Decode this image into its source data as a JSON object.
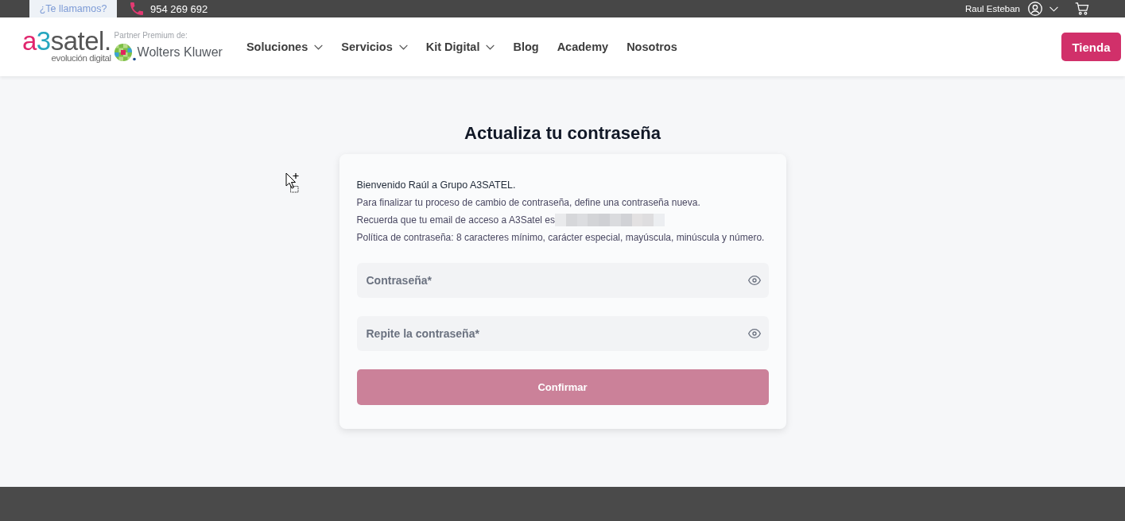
{
  "top_bar": {
    "callback_label": "¿Te llamamos?",
    "phone": "954 269 692",
    "user_name": "Raul Esteban"
  },
  "header": {
    "logo": {
      "wordmark": [
        "a",
        "3",
        "satel."
      ],
      "tagline": "evolución digital"
    },
    "partner": {
      "caption": "Partner Premium de:",
      "name": "Wolters Kluwer"
    },
    "nav": [
      {
        "label": "Soluciones",
        "has_menu": true
      },
      {
        "label": "Servicios",
        "has_menu": true
      },
      {
        "label": "Kit Digital",
        "has_menu": true
      },
      {
        "label": "Blog",
        "has_menu": false
      },
      {
        "label": "Academy",
        "has_menu": false
      },
      {
        "label": "Nosotros",
        "has_menu": false
      }
    ],
    "shop_button": "Tienda"
  },
  "form": {
    "title": "Actualiza tu contraseña",
    "greeting": "Bienvenido Raúl a Grupo A3SATEL.",
    "intro": "Para finalizar tu proceso de cambio de contraseña, define una contraseña nueva.",
    "email_notice": {
      "text": "Recuerda que tu email de acceso a A3Satel es",
      "value_redacted": true
    },
    "policy": "Política de contraseña: 8 caracteres mínimo, carácter especial, mayúscula, minúscula y número.",
    "fields": [
      {
        "placeholder": "Contraseña*"
      },
      {
        "placeholder": "Repite la contraseña*"
      }
    ],
    "submit": {
      "label": "Confirmar",
      "disabled": true
    }
  }
}
